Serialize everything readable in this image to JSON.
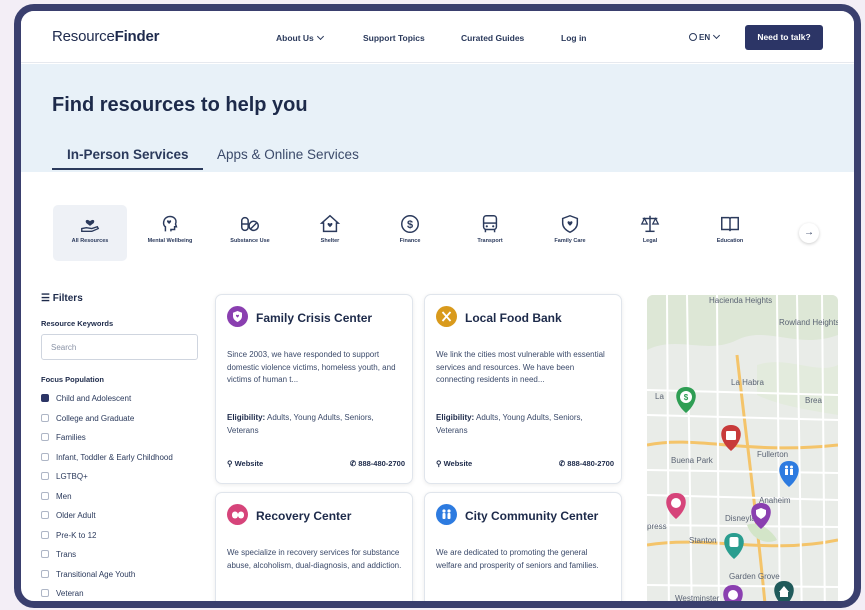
{
  "nav": {
    "logo_a": "Resource",
    "logo_b": "Finder",
    "links": [
      "About Us",
      "Support Topics",
      "Curated Guides",
      "Log in"
    ],
    "lang": "EN",
    "cta": "Need to talk?"
  },
  "hero": {
    "title": "Find resources to help you",
    "tabs": [
      "In-Person Services",
      "Apps & Online Services"
    ]
  },
  "categories": [
    {
      "label": "All Resources",
      "icon": "hand-heart-icon"
    },
    {
      "label": "Mental Wellbeing",
      "icon": "head-heart-icon"
    },
    {
      "label": "Substance Use",
      "icon": "pills-icon"
    },
    {
      "label": "Shelter",
      "icon": "house-heart-icon"
    },
    {
      "label": "Finance",
      "icon": "dollar-icon"
    },
    {
      "label": "Transport",
      "icon": "bus-icon"
    },
    {
      "label": "Family Care",
      "icon": "shield-heart-icon"
    },
    {
      "label": "Legal",
      "icon": "scales-icon"
    },
    {
      "label": "Education",
      "icon": "book-icon"
    }
  ],
  "filters": {
    "title": "Filters",
    "keywords_label": "Resource Keywords",
    "search_placeholder": "Search",
    "focus_label": "Focus Population",
    "options": [
      {
        "label": "Child and Adolescent",
        "checked": true
      },
      {
        "label": "College and Graduate",
        "checked": false
      },
      {
        "label": "Families",
        "checked": false
      },
      {
        "label": "Infant, Toddler & Early Childhood",
        "checked": false
      },
      {
        "label": "LGTBQ+",
        "checked": false
      },
      {
        "label": "Men",
        "checked": false
      },
      {
        "label": "Older Adult",
        "checked": false
      },
      {
        "label": "Pre-K to 12",
        "checked": false
      },
      {
        "label": "Trans",
        "checked": false
      },
      {
        "label": "Transitional Age Youth",
        "checked": false
      },
      {
        "label": "Veteran",
        "checked": false
      }
    ]
  },
  "cards": [
    {
      "title": "Family Crisis Center",
      "color": "#8a3fb0",
      "icon": "shield-heart-icon",
      "desc": "Since 2003, we have responded to support domestic violence victims, homeless youth, and victims of human t...",
      "elig_label": "Eligibility:",
      "elig": "Adults, Young Adults, Seniors, Veterans",
      "website": "Website",
      "phone": "888-480-2700"
    },
    {
      "title": "Local Food Bank",
      "color": "#d99a1c",
      "icon": "utensils-icon",
      "desc": "We link the cities most vulnerable with essential services and resources. We have been connecting residents in need...",
      "elig_label": "Eligibility:",
      "elig": "Adults, Young Adults, Seniors, Veterans",
      "website": "Website",
      "phone": "888-480-2700"
    },
    {
      "title": "Recovery Center",
      "color": "#d6447a",
      "icon": "pills-icon",
      "desc": "We specialize in recovery services for substance abuse, alcoholism, dual-diagnosis, and addiction.",
      "elig_label": "",
      "elig": "",
      "website": "",
      "phone": ""
    },
    {
      "title": "City Community Center",
      "color": "#2d7be0",
      "icon": "people-icon",
      "desc": "We are dedicated to promoting the general welfare and prosperity of seniors and families.",
      "elig_label": "",
      "elig": "",
      "website": "",
      "phone": ""
    }
  ],
  "map": {
    "places": [
      "Hacienda Heights",
      "Rowland Heights",
      "La Habra",
      "Fullerton",
      "Buena Park",
      "Anaheim",
      "Disneyland",
      "Stanton",
      "Garden Grove",
      "Westminster",
      "La",
      "Brea",
      "press"
    ]
  }
}
